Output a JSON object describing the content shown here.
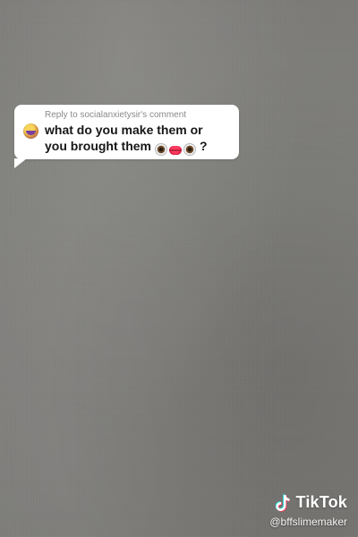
{
  "reply": {
    "header": "Reply to socialanxietysir's comment",
    "line1": "what do you make them or",
    "line2": "you brought them",
    "trailing": "?",
    "avatar_icon": "avatar-emoji-icon",
    "emojis": [
      "eye-icon",
      "lips-icon",
      "eye-icon"
    ]
  },
  "watermark": {
    "brand": "TikTok",
    "handle": "@bffslimemaker",
    "icon": "tiktok-logo-icon"
  },
  "colors": {
    "background": "#7f7e7b",
    "bubble": "#ffffff",
    "header_text": "#8a8a8a",
    "comment_text": "#161616",
    "watermark_text": "#ffffff"
  }
}
